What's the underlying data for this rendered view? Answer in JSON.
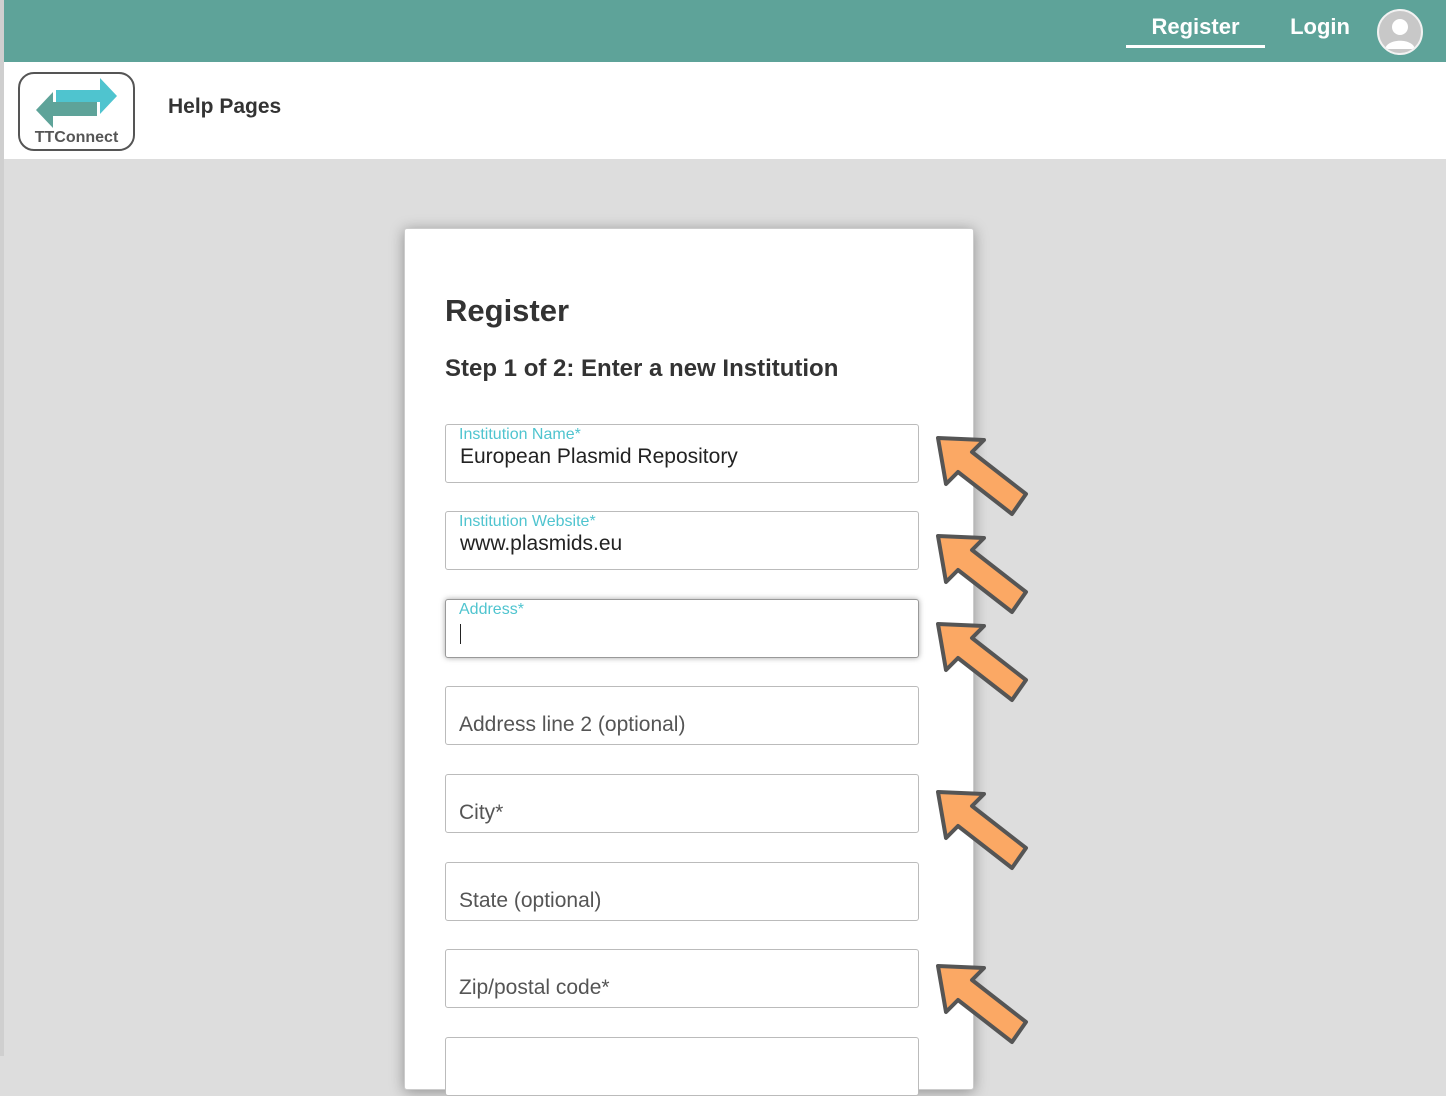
{
  "topbar": {
    "register_label": "Register",
    "login_label": "Login",
    "color": "#5ea399"
  },
  "header": {
    "logo_text": "TTConnect",
    "help_pages_label": "Help Pages"
  },
  "form": {
    "title": "Register",
    "subtitle": "Step 1 of 2: Enter a new Institution",
    "fields": [
      {
        "label": "Institution Name*",
        "value": "European Plasmid Repository"
      },
      {
        "label": "Institution Website*",
        "value": "www.plasmids.eu"
      },
      {
        "label": "Address*",
        "value": ""
      },
      {
        "placeholder": "Address line 2 (optional)"
      },
      {
        "placeholder": "City*"
      },
      {
        "placeholder": "State (optional)"
      },
      {
        "placeholder": "Zip/postal code*"
      }
    ],
    "label_color": "#4fc4cf"
  },
  "annotations": {
    "arrow_color": "#fba864",
    "arrow_icon": "annotation-arrow-icon"
  }
}
